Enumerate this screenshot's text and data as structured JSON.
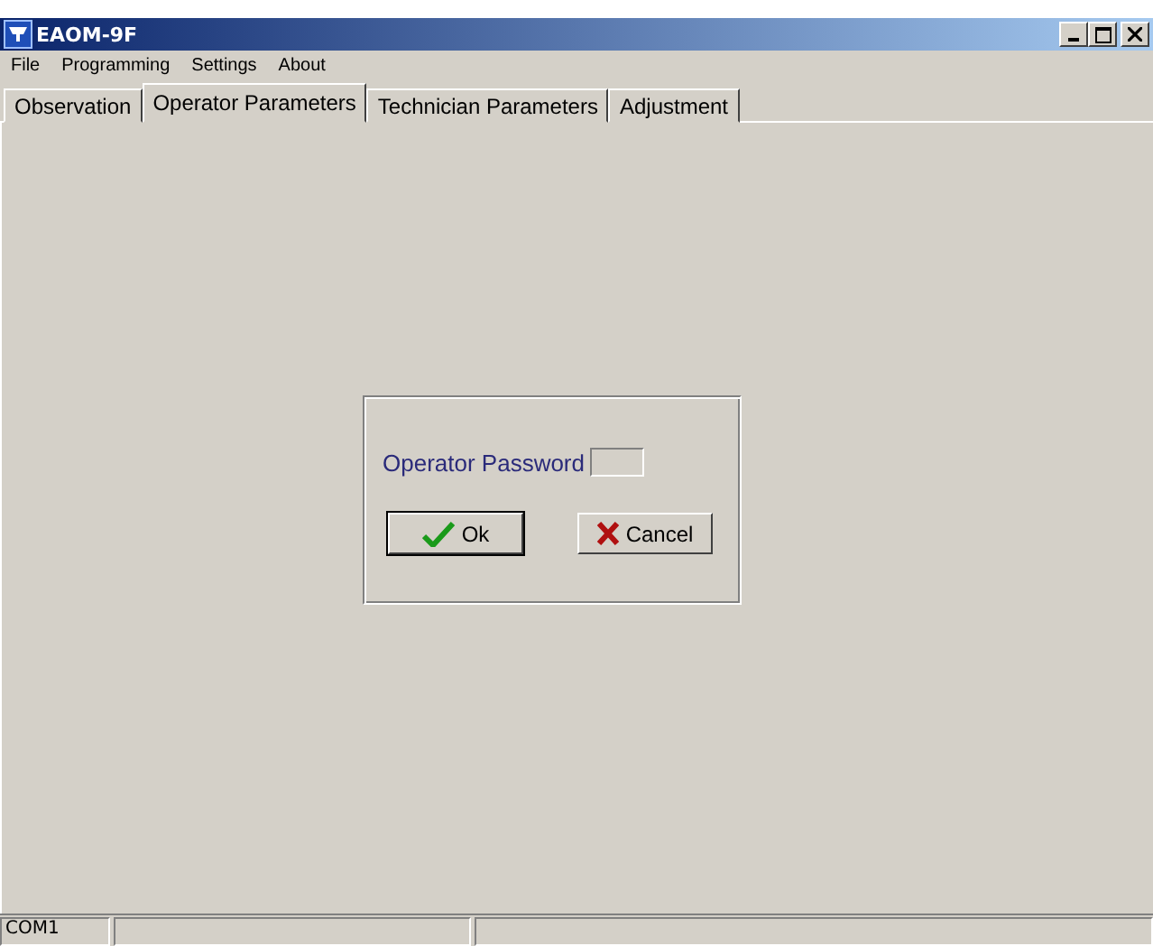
{
  "window": {
    "title": "EAOM-9F"
  },
  "menu": [
    "File",
    "Programming",
    "Settings",
    "About"
  ],
  "tabs": [
    {
      "label": "Observation",
      "selected": false
    },
    {
      "label": "Operator Parameters",
      "selected": true
    },
    {
      "label": "Technician Parameters",
      "selected": false
    },
    {
      "label": "Adjustment",
      "selected": false
    }
  ],
  "dialog": {
    "password_label": "Operator Password",
    "ok": "Ok",
    "cancel": "Cancel"
  },
  "status_bar": [
    "COM1"
  ]
}
